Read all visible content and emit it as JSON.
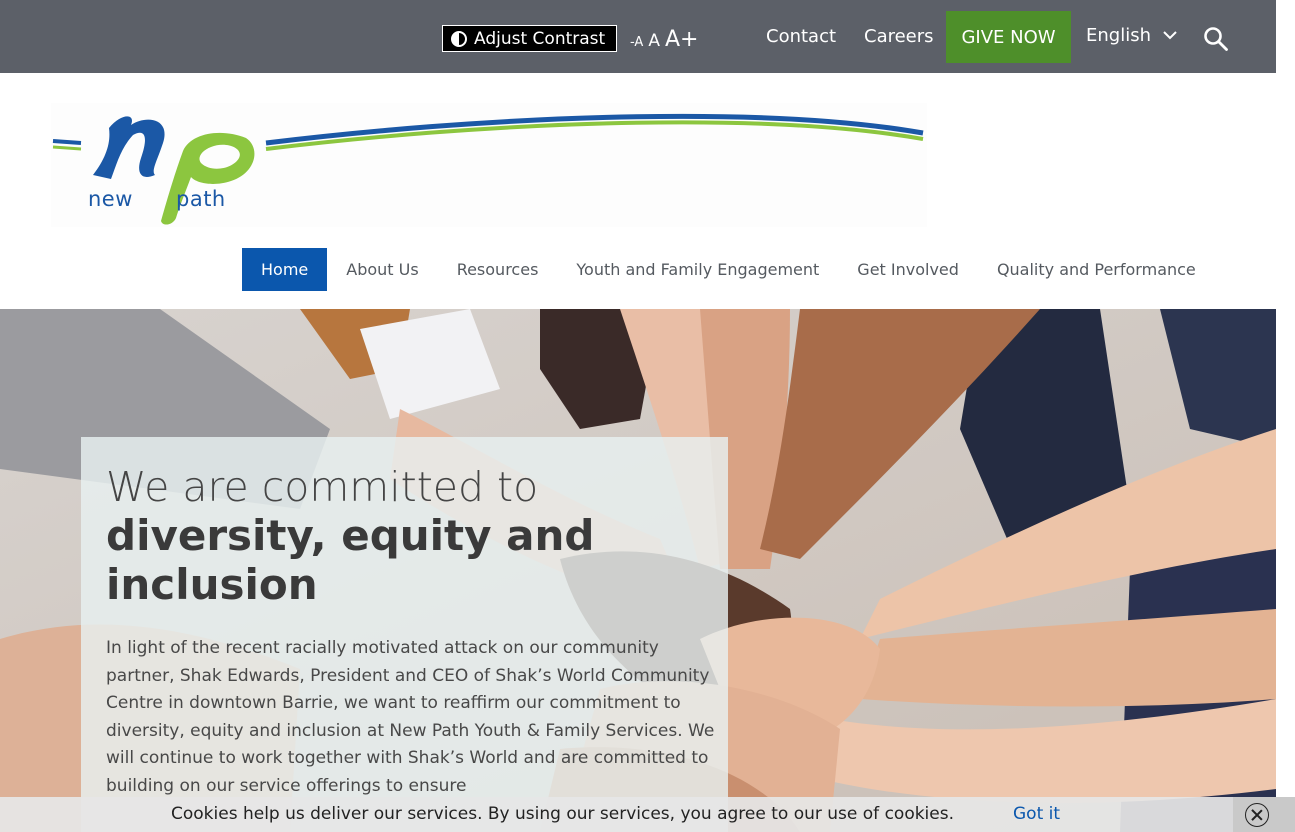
{
  "topbar": {
    "adjust_contrast": "Adjust Contrast",
    "font_small": "-A",
    "font_medium": "A",
    "font_large": "A+",
    "contact": "Contact",
    "careers": "Careers",
    "give_now": "GIVE NOW",
    "language": "English"
  },
  "logo": {
    "word1": "new",
    "word2": "path"
  },
  "nav": {
    "items": [
      {
        "label": "Home"
      },
      {
        "label": "About Us"
      },
      {
        "label": "Resources"
      },
      {
        "label": "Youth and Family Engagement"
      },
      {
        "label": "Get Involved"
      },
      {
        "label": "Quality and Performance"
      }
    ]
  },
  "hero": {
    "title_light": "We are committed to",
    "title_bold": "diversity, equity and inclusion",
    "body": "In light of the recent racially motivated attack on our community partner, Shak Edwards, President and CEO of Shak’s World Community Centre in downtown Barrie, we want to reaffirm our commitment to diversity, equity and inclusion at New Path Youth & Family Services. We will continue to work together with Shak’s World and are committed to building on our service offerings to ensure"
  },
  "cookie": {
    "text": "Cookies help us deliver our services. By using our services, you agree to our use of cookies.",
    "accept": "Got it"
  },
  "colors": {
    "topbar": "#5c6068",
    "give_now": "#4e8f2a",
    "nav_active": "#0b57ad",
    "logo_blue": "#1b58a6",
    "logo_green": "#8cc63f"
  }
}
